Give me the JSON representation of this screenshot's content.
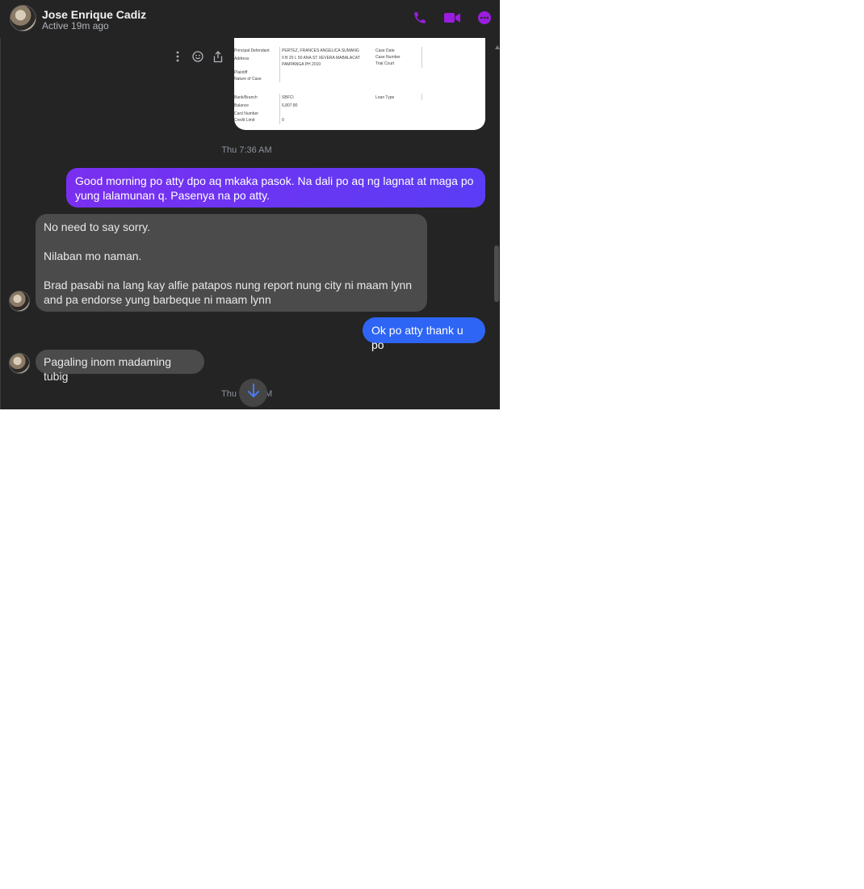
{
  "header": {
    "name": "Jose Enrique Cadiz",
    "status": "Active 19m ago",
    "icons": [
      "phone-icon",
      "video-icon",
      "more-icon"
    ],
    "accent_color": "#9b1de0"
  },
  "attachment": {
    "labels": [
      "Principal Defendant",
      "Address",
      "Plaintiff",
      "Nature of Case",
      "Bank/Branch",
      "Balance",
      "Card Number",
      "Credit Limit"
    ],
    "values": [
      "PERTEZ, FRANCES ANGELICA SUMANG",
      "0 B 20 L 50 ANA ST XEVERA MABALACAT",
      "PAMPANGA PH 2010",
      "SBFCI",
      "6,807.80",
      "0"
    ],
    "right_labels": [
      "Case Date",
      "Case Number",
      "Trial Court",
      "Loan Type"
    ]
  },
  "timestamp1": "Thu 7:36 AM",
  "messages": [
    {
      "from": "me",
      "lines": [
        "Good morning po atty dpo aq mkaka pasok. Na dali po aq ng lagnat at maga po",
        "yung lalamunan q. Pasenya na po atty."
      ]
    },
    {
      "from": "them",
      "lines": [
        "No need to say sorry.",
        "Nilaban mo naman.",
        "Brad pasabi na lang kay alfie patapos nung report nung city ni maam lynn",
        "and pa endorse yung barbeque ni maam lynn"
      ]
    },
    {
      "from": "me",
      "lines": [
        "Ok po atty thank u po"
      ]
    },
    {
      "from": "them",
      "lines": [
        "Pagaling inom madaming tubig"
      ]
    }
  ],
  "timestamp2_left": "Thu",
  "timestamp2_right": "M",
  "colors": {
    "bubble_out_gradient_start": "#7a2ff0",
    "bubble_out_gradient_end": "#5b3df6",
    "bubble_out_blue": "#2e65f4",
    "bubble_in": "#4b4b4b",
    "background": "#242424"
  }
}
